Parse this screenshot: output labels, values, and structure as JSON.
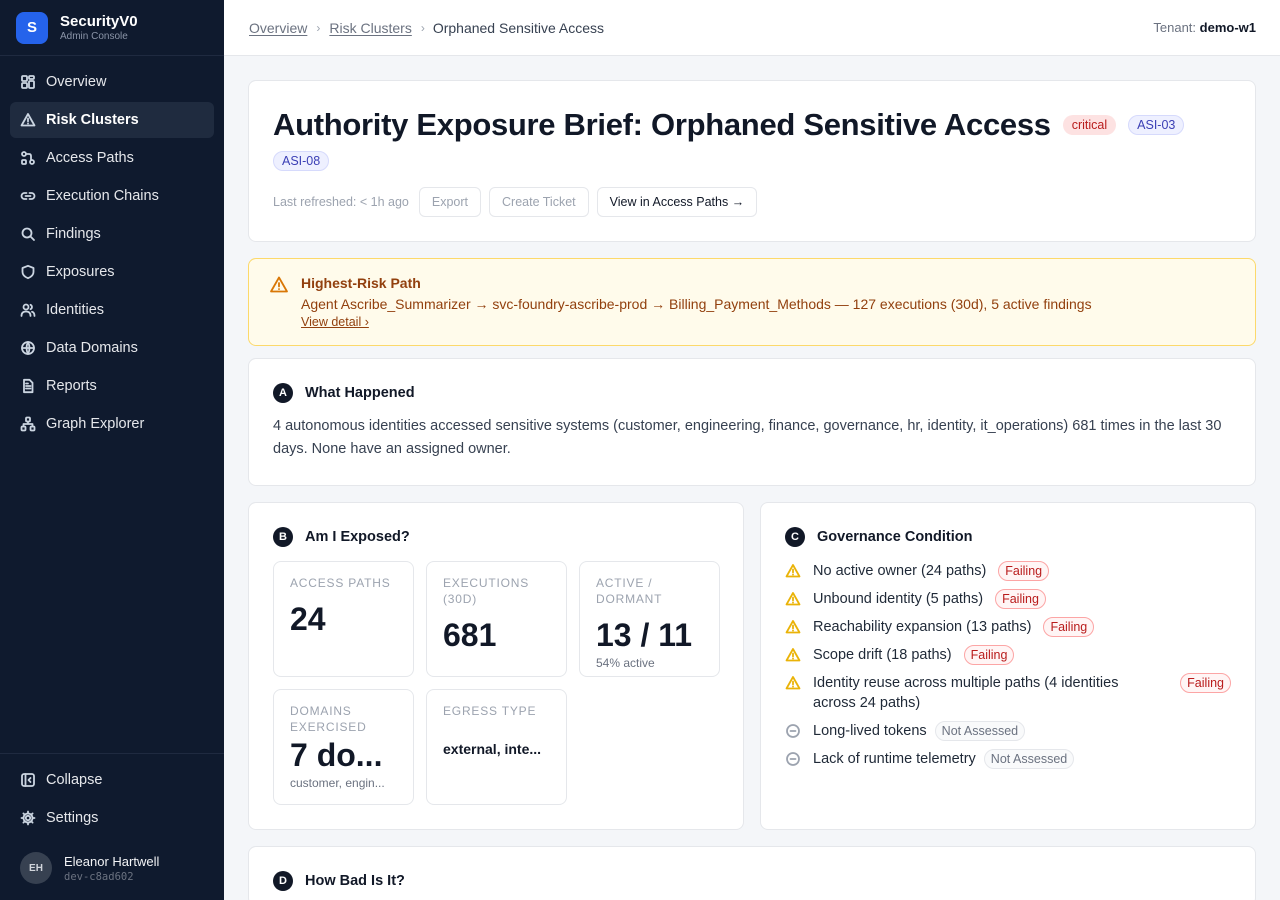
{
  "brand": {
    "logo_letter": "S",
    "name": "SecurityV0",
    "subtitle": "Admin Console"
  },
  "nav": [
    {
      "label": "Overview",
      "icon": "grid-icon"
    },
    {
      "label": "Risk Clusters",
      "icon": "warning-icon",
      "active": true
    },
    {
      "label": "Access Paths",
      "icon": "path-icon"
    },
    {
      "label": "Execution Chains",
      "icon": "link-icon"
    },
    {
      "label": "Findings",
      "icon": "search-icon"
    },
    {
      "label": "Exposures",
      "icon": "shield-icon"
    },
    {
      "label": "Identities",
      "icon": "users-icon"
    },
    {
      "label": "Data Domains",
      "icon": "globe-icon"
    },
    {
      "label": "Reports",
      "icon": "document-icon"
    },
    {
      "label": "Graph Explorer",
      "icon": "graph-icon"
    }
  ],
  "sidebar_bottom": {
    "collapse": "Collapse",
    "settings": "Settings"
  },
  "user": {
    "initials": "EH",
    "name": "Eleanor Hartwell",
    "id": "dev-c8ad602"
  },
  "breadcrumb": {
    "items": [
      "Overview",
      "Risk Clusters"
    ],
    "current": "Orphaned Sensitive Access",
    "separator": "›"
  },
  "tenant": {
    "label": "Tenant:",
    "value": "demo-w1"
  },
  "hero": {
    "title": "Authority Exposure Brief: Orphaned Sensitive Access",
    "severity": "critical",
    "tags": [
      "ASI-03",
      "ASI-08"
    ],
    "refreshed": "Last refreshed: < 1h ago",
    "buttons": {
      "export": "Export",
      "ticket": "Create Ticket",
      "view": "View in Access Paths →"
    }
  },
  "alert": {
    "title": "Highest-Risk Path",
    "text": "Agent Ascribe_Summarizer → svc-foundry-ascribe-prod → Billing_Payment_Methods — 127 executions (30d), 5 active findings",
    "link": "View detail ›"
  },
  "what_happened": {
    "letter": "A",
    "title": "What Happened",
    "text": "4 autonomous identities accessed sensitive systems (customer, engineering, finance, governance, hr, identity, it_operations) 681 times in the last 30 days. None have an assigned owner."
  },
  "exposed": {
    "letter": "B",
    "title": "Am I Exposed?",
    "metrics": [
      {
        "label": "Access Paths",
        "value": "24",
        "sub": ""
      },
      {
        "label": "Executions (30d)",
        "value": "681",
        "sub": ""
      },
      {
        "label": "Active / Dormant",
        "value": "13 / 11",
        "sub": "54% active"
      },
      {
        "label": "Domains Exercised",
        "value": "7 do...",
        "sub": "customer, engin..."
      },
      {
        "label": "Egress Type",
        "value": "external, inte...",
        "sub": ""
      }
    ]
  },
  "governance": {
    "letter": "C",
    "title": "Governance Condition",
    "items": [
      {
        "text": "No active owner (24 paths)",
        "status": "Failing"
      },
      {
        "text": "Unbound identity (5 paths)",
        "status": "Failing"
      },
      {
        "text": "Reachability expansion (13 paths)",
        "status": "Failing"
      },
      {
        "text": "Scope drift (18 paths)",
        "status": "Failing"
      },
      {
        "text": "Identity reuse across multiple paths (4 identities across 24 paths)",
        "status": "Failing"
      },
      {
        "text": "Long-lived tokens",
        "status": "Not Assessed"
      },
      {
        "text": "Lack of runtime telemetry",
        "status": "Not Assessed"
      }
    ]
  },
  "next_section": {
    "letter": "D",
    "title": "How Bad Is It?"
  }
}
